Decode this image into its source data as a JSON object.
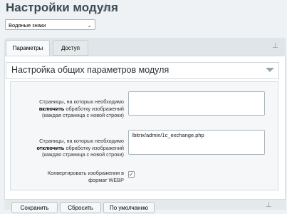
{
  "header": {
    "title": "Настройки модуля",
    "favorite_icon": "star-icon"
  },
  "site_select": {
    "selected": "Водяные знаки"
  },
  "tabs": [
    {
      "label": "Параметры",
      "active": true
    },
    {
      "label": "Доступ",
      "active": false
    }
  ],
  "section": {
    "title": "Настройка общих параметров модуля"
  },
  "fields": {
    "include": {
      "line1": "Страницы, на которых необходимо",
      "line2_bold": "включить",
      "line2_rest": " обработку изображений",
      "line3": "(каждая страница с новой строки)",
      "value": ""
    },
    "exclude": {
      "line1": "Страницы, на которых необходимо",
      "line2_bold": "отключить",
      "line2_rest": " обработку изображений",
      "line3": "(каждая страница с новой строки)",
      "value": "/bitrix/admin/1c_exchange.php"
    },
    "webp": {
      "line1": "Конвертировать изображения в",
      "line2": "формат WEBP",
      "checked": true
    }
  },
  "buttons": {
    "save": "Сохранить",
    "reset": "Сбросить",
    "default": "По умолчанию"
  }
}
